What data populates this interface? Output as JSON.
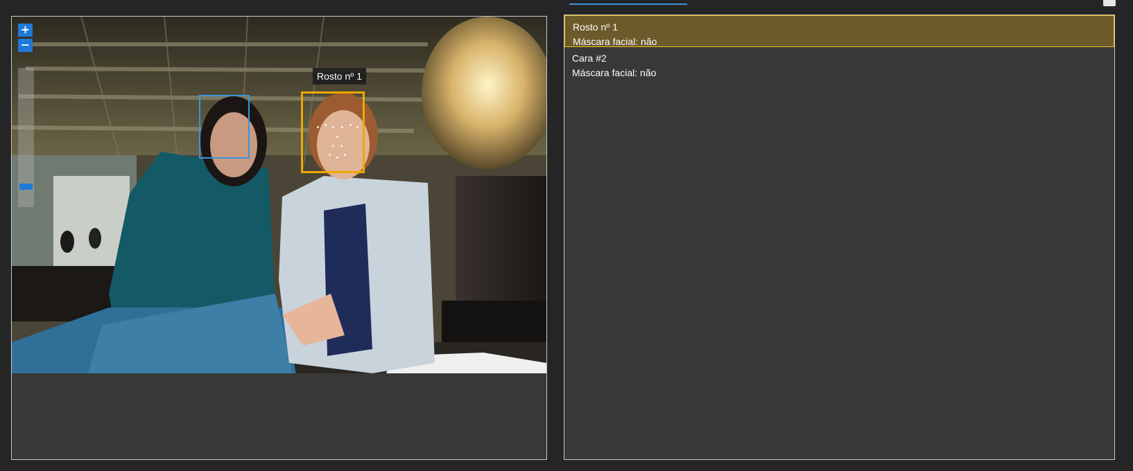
{
  "faces": [
    {
      "label": "Rosto nº 1",
      "mask_label": "Máscara facial: não",
      "selected": true
    },
    {
      "label": "Cara #2",
      "mask_label": "Máscara facial: não",
      "selected": false
    }
  ],
  "image_viewer": {
    "zoom_in_label": "+",
    "zoom_out_label": "−",
    "tooltip_label": "Rosto nº 1"
  },
  "colors": {
    "selected_box": "#f0a800",
    "unselected_box": "#3a96dd",
    "selected_row_bg": "#6d5a2b",
    "accent": "#1e7ad6"
  }
}
